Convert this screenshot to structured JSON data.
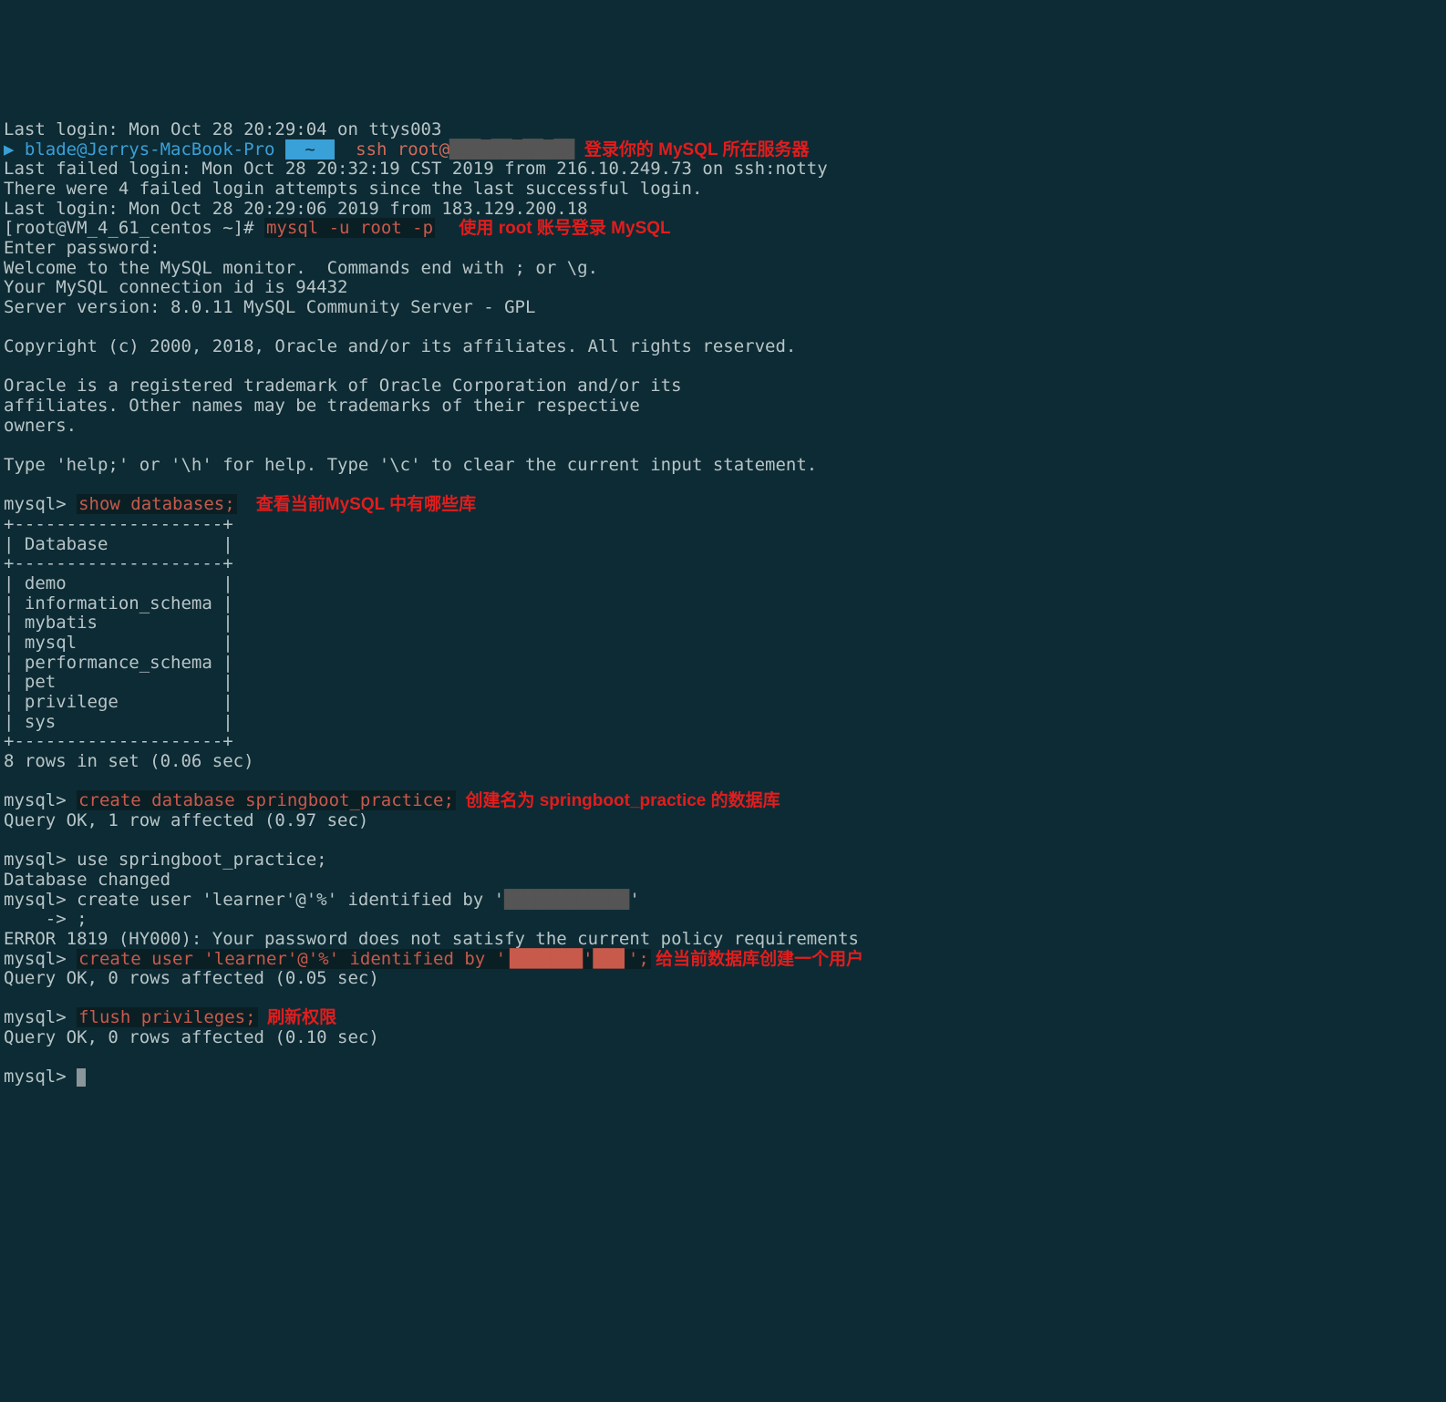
{
  "line_lastlogin1": "Last login: Mon Oct 28 20:29:04 on ttys003",
  "prompt_arrow": "▶",
  "prompt_userhost": " blade@Jerrys-MacBook-Pro ",
  "prompt_tilde": " ~ ",
  "ssh_cmd": "  ssh root@",
  "ssh_cmd_censored": "███.██.██.██",
  "anno_ssh": "  登录你的 MySQL 所在服务器",
  "line_lastfailed": "Last failed login: Mon Oct 28 20:32:19 CST 2019 from 216.10.249.73 on ssh:notty",
  "line_failedattempts": "There were 4 failed login attempts since the last successful login.",
  "line_lastlogin2": "Last login: Mon Oct 28 20:29:06 2019 from 183.129.200.18",
  "root_prompt": "[root@VM_4_61_centos ~]# ",
  "mysql_login_cmd": "mysql -u root -p",
  "anno_mysql_login": "     使用 root 账号登录 MySQL",
  "line_enterpw": "Enter password:",
  "line_welcome": "Welcome to the MySQL monitor.  Commands end with ; or \\g.",
  "line_connid": "Your MySQL connection id is 94432",
  "line_serverver": "Server version: 8.0.11 MySQL Community Server - GPL",
  "line_copyright": "Copyright (c) 2000, 2018, Oracle and/or its affiliates. All rights reserved.",
  "line_oracle1": "Oracle is a registered trademark of Oracle Corporation and/or its",
  "line_oracle2": "affiliates. Other names may be trademarks of their respective",
  "line_oracle3": "owners.",
  "line_help": "Type 'help;' or '\\h' for help. Type '\\c' to clear the current input statement.",
  "mysql_prompt": "mysql> ",
  "cmd_showdb": "show databases;",
  "anno_showdb": "    查看当前MySQL 中有哪些库",
  "db_border": "+--------------------+",
  "db_header": "| Database           |",
  "db_rows": [
    "| demo               |",
    "| information_schema |",
    "| mybatis            |",
    "| mysql              |",
    "| performance_schema |",
    "| pet                |",
    "| privilege          |",
    "| sys                |"
  ],
  "db_rowcount": "8 rows in set (0.06 sec)",
  "cmd_createdb": "create database springboot_practice;",
  "anno_createdb": "  创建名为 springboot_practice 的数据库",
  "line_createdb_ok": "Query OK, 1 row affected (0.97 sec)",
  "cmd_usedb": "use springboot_practice;",
  "line_dbchanged": "Database changed",
  "cmd_createuser1a": "create user 'learner'@'%' identified by '",
  "cmd_createuser1_censored": "████████████",
  "cmd_createuser1b": "'",
  "line_arrow_cont": "    -> ;",
  "line_error1819": "ERROR 1819 (HY000): Your password does not satisfy the current policy requirements",
  "cmd_createuser2a": "create user 'learner'@'%' identified by '",
  "cmd_createuser2_censored": "███████'███",
  "cmd_createuser2b": "';",
  "anno_createuser": " 给当前数据库创建一个用户",
  "line_createuser_ok": "Query OK, 0 rows affected (0.05 sec)",
  "cmd_flush": "flush privileges;",
  "anno_flush": "  刷新权限",
  "line_flush_ok": "Query OK, 0 rows affected (0.10 sec)"
}
